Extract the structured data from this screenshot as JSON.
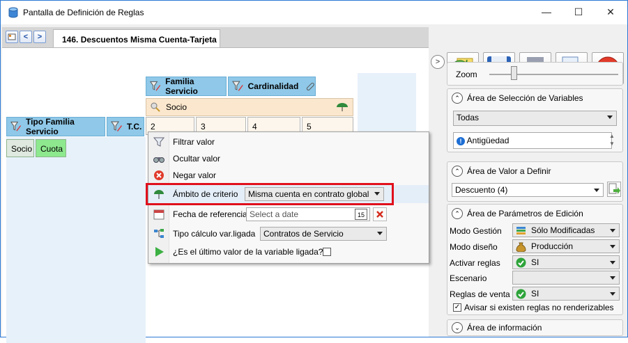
{
  "window": {
    "title": "Pantalla de Definición de Reglas",
    "minimize": "—",
    "maximize": "☐",
    "close": "✕"
  },
  "doc": {
    "tab_label": "146. Descuentos Misma Cuenta-Tarjeta",
    "nav_prev": "<",
    "nav_next": ">"
  },
  "canvas": {
    "header_familia": "Familia Servicio",
    "header_cardinalidad": "Cardinalidad",
    "header_tipo_familia": "Tipo Familia Servicio",
    "header_tc": "T.C.",
    "socio_row": "Socio",
    "num_cells": [
      "2",
      "3",
      "4",
      "5"
    ],
    "pills": [
      "Socio",
      "Cuota"
    ]
  },
  "context_menu": {
    "filtrar": "Filtrar valor",
    "ocultar": "Ocultar valor",
    "negar": "Negar valor",
    "ambito_label": "Ámbito de criterio",
    "ambito_value": "Misma cuenta en contrato global",
    "fecha_label": "Fecha de referencia",
    "fecha_placeholder": "Select a date",
    "fecha_calendar_day": "15",
    "tipo_label": "Tipo cálculo var.ligada",
    "tipo_value": "Contratos de Servicio",
    "ultimo_label": "¿Es el último valor de la variable ligada?"
  },
  "right": {
    "collapse_glyph": ">",
    "zoom_label": "Zoom",
    "sel_vars_title": "Área de Selección de Variables",
    "sel_vars_combo": "Todas",
    "sel_vars_item": "Antigüedad",
    "valor_title": "Área de Valor a Definir",
    "valor_combo": "Descuento (4)",
    "params_title": "Área de Parámetros de Edición",
    "params": [
      {
        "label": "Modo Gestión",
        "value": "Sólo Modificadas"
      },
      {
        "label": "Modo diseño",
        "value": "Producción"
      },
      {
        "label": "Activar reglas",
        "value": "SI"
      },
      {
        "label": "Escenario",
        "value": ""
      },
      {
        "label": "Reglas de venta",
        "value": "SI"
      }
    ],
    "avisar_label": "Avisar si existen reglas no renderizables",
    "info_title": "Área de información"
  },
  "colors": {
    "header_blue": "#8fc8e8",
    "socio_peach": "#fbe7cd",
    "pill_gray": "#dfe9df",
    "pill_green": "#8ee88e",
    "highlight_red": "#e0101c",
    "accent_window": "#2b78d4"
  }
}
